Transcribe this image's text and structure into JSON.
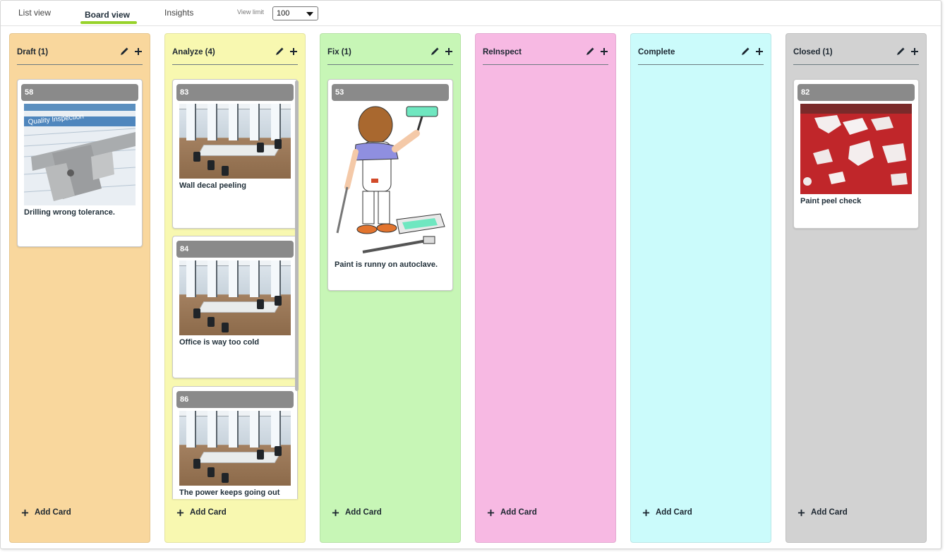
{
  "tabs": [
    {
      "label": "List view",
      "active": false
    },
    {
      "label": "Board view",
      "active": true
    },
    {
      "label": "Insights",
      "active": false
    }
  ],
  "view_limit": {
    "label": "View limit",
    "value": "100"
  },
  "accent_color": "#97d22a",
  "columns": [
    {
      "title": "Draft (1)",
      "color": "#f9d79d",
      "add_label": "Add Card",
      "cards": [
        {
          "id": "58",
          "title": "Drilling wrong tolerance.",
          "image": "caliper-quality-inspection"
        }
      ]
    },
    {
      "title": "Analyze (4)",
      "color": "#f8f8b0",
      "add_label": "Add Card",
      "cards": [
        {
          "id": "83",
          "title": "Wall decal peeling",
          "image": "office-room"
        },
        {
          "id": "84",
          "title": "Office is way too cold",
          "image": "office-room"
        },
        {
          "id": "86",
          "title": "The power keeps going out",
          "image": "office-room"
        }
      ]
    },
    {
      "title": "Fix (1)",
      "color": "#c7f6b6",
      "add_label": "Add Card",
      "cards": [
        {
          "id": "53",
          "title": "Paint is runny on autoclave.",
          "image": "painter-cartoon"
        }
      ]
    },
    {
      "title": "ReInspect",
      "color": "#f7b9e3",
      "add_label": "Add Card",
      "cards": []
    },
    {
      "title": "Complete",
      "color": "#cbfbfb",
      "add_label": "Add Card",
      "cards": []
    },
    {
      "title": "Closed (1)",
      "color": "#d2d2d2",
      "add_label": "Add Card",
      "cards": [
        {
          "id": "82",
          "title": "Paint peel check",
          "image": "peeling-red-paint"
        }
      ]
    }
  ],
  "icons": {
    "edit": "pencil-icon",
    "add": "plus-icon",
    "dropdown": "chevron-down-icon"
  }
}
